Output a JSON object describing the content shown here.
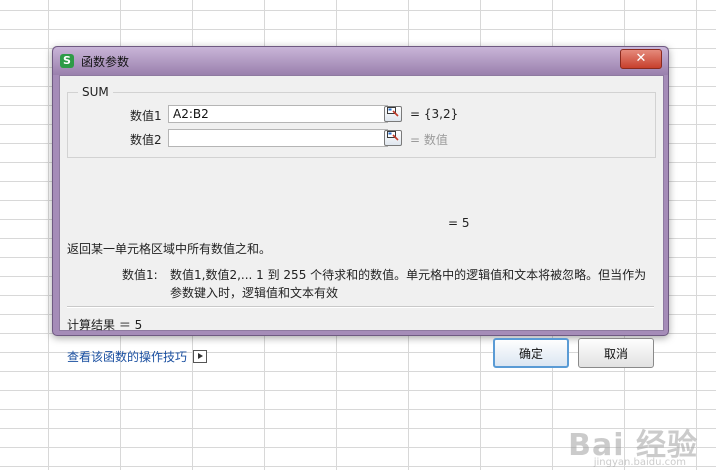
{
  "dialog": {
    "title": "函数参数",
    "app_icon": "S",
    "close_label": "✕",
    "function_name": "SUM",
    "args": [
      {
        "label": "数值1",
        "value": "A2:B2",
        "result": "= {3,2}"
      },
      {
        "label": "数值2",
        "value": "",
        "result": "= 数值"
      }
    ],
    "total_result": "=   5",
    "description": "返回某一单元格区域中所有数值之和。",
    "param_name": "数值1:",
    "param_description": "数值1,数值2,... 1 到 255 个待求和的数值。单元格中的逻辑值和文本将被忽略。但当作为参数键入时，逻辑值和文本有效",
    "calc_result": "计算结果 ＝ 5",
    "help_link": "查看该函数的操作技巧",
    "ok_label": "确定",
    "cancel_label": "取消"
  },
  "watermark": {
    "text": "Bai 经验",
    "sub": "jingyan.baidu.com"
  },
  "colors": {
    "accent_purple": "#a58cb8",
    "close_red": "#c7402d",
    "link_blue": "#1a4fa0",
    "app_green": "#2e9b47"
  }
}
